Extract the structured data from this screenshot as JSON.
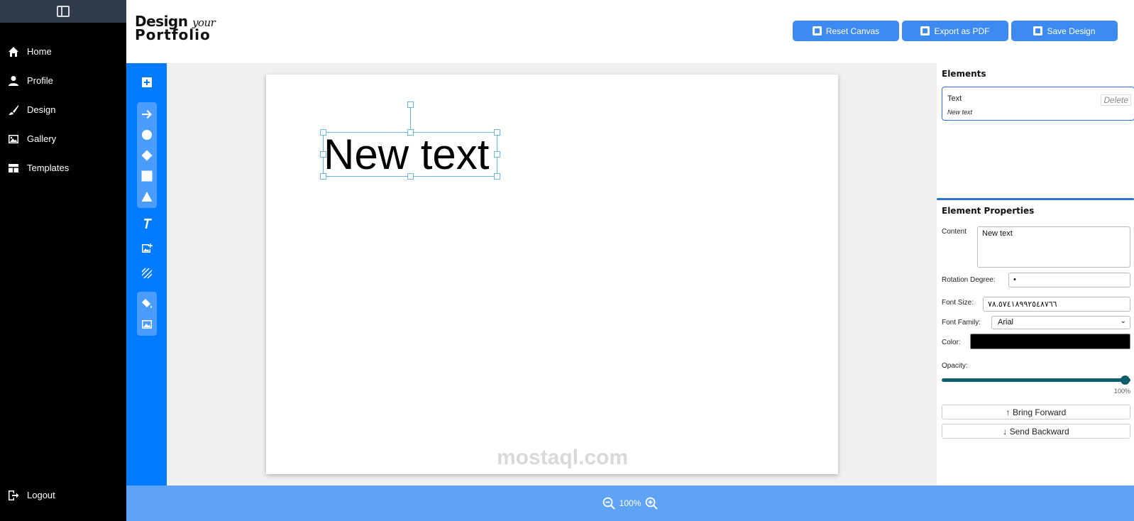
{
  "sidebar": {
    "items": [
      {
        "label": "Home",
        "icon": "home-icon"
      },
      {
        "label": "Profile",
        "icon": "user-icon"
      },
      {
        "label": "Design",
        "icon": "brush-icon"
      },
      {
        "label": "Gallery",
        "icon": "image-icon"
      },
      {
        "label": "Templates",
        "icon": "template-icon"
      }
    ],
    "logout": "Logout"
  },
  "header": {
    "logo_line1": "Design",
    "logo_line1_script": "your",
    "logo_line2": "Portfolio",
    "reset": "Reset Canvas",
    "export": "Export as PDF",
    "save": "Save Design",
    "button_color": "#3d8bf0"
  },
  "canvas": {
    "text": "New text"
  },
  "panel": {
    "elements_title": "Elements",
    "element_type": "Text",
    "element_preview": "New text",
    "delete": "Delete",
    "props_title": "Element Properties",
    "content_label": "Content",
    "content_value": "New text",
    "rotation_label": "Rotation Degree:",
    "rotation_value": "•",
    "font_size_label": "Font Size:",
    "font_size_value": "٧٨.٥٧٤١٨٩٩٢٥٤٨٧٦٦",
    "font_family_label": "Font Family:",
    "font_family_value": "Arial",
    "color_label": "Color:",
    "color_value": "#000000",
    "opacity_label": "Opacity:",
    "opacity_value": "100%",
    "bring_forward": "↑ Bring Forward",
    "send_backward": "↓ Send Backward"
  },
  "zoom": {
    "level": "100%"
  },
  "watermark": "mostaql.com",
  "colors": {
    "toolbar": "#007bff",
    "bottom_bar": "#5ea3f5",
    "accent": "#2d72d0"
  }
}
